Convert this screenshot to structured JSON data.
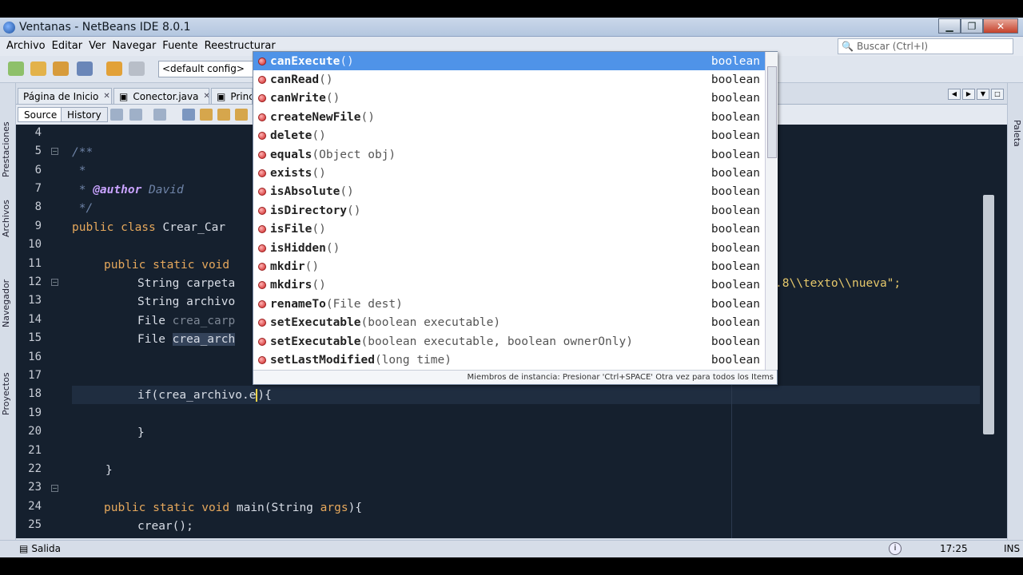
{
  "window": {
    "title": "Ventanas - NetBeans IDE 8.0.1"
  },
  "menu": {
    "items": [
      "Archivo",
      "Editar",
      "Ver",
      "Navegar",
      "Fuente",
      "Reestructurar"
    ]
  },
  "search": {
    "placeholder": "Buscar (Ctrl+I)"
  },
  "toolbar": {
    "config": "<default config>"
  },
  "left_panels": [
    "Prestaciones",
    "Archivos",
    "Navegador",
    "Proyectos"
  ],
  "right_panels": [
    "Paleta"
  ],
  "editor_tabs": [
    {
      "label": "Página de Inicio"
    },
    {
      "label": "Conector.java"
    },
    {
      "label": "Princip"
    }
  ],
  "editor_toolbar": {
    "source": "Source",
    "history": "History"
  },
  "code": {
    "line_numbers": [
      "4",
      "5",
      "6",
      "7",
      "8",
      "9",
      "10",
      "11",
      "12",
      "13",
      "14",
      "15",
      "16",
      "17",
      "18",
      "19",
      "20",
      "21",
      "22",
      "23",
      "24",
      "25"
    ],
    "l4": "/**",
    "l5": " *",
    "l7": " */",
    "l9a": "public class ",
    "l9b": "Crear_Car",
    "l11a": "public static void",
    "l12a": "String carpeta",
    "l12b": ".8\\\\texto\\\\nueva\";",
    "l13": "String archivo",
    "l14a": "File ",
    "l14b": "crea_carp",
    "l15a": "File ",
    "l15b": "crea_arch",
    "l17a": "if(",
    "l17b": "crea_archivo.e",
    "l17c": "){",
    "l19": "}",
    "l21": "}",
    "l23a": "public static void",
    "l23b": " main(String ",
    "l23c": "args",
    "l23d": "){",
    "l24": "crear();",
    "l25": "}",
    "author_tag": "@author",
    "author_name": "David"
  },
  "completion": {
    "items": [
      {
        "name": "canExecute",
        "args": "()",
        "ret": "boolean"
      },
      {
        "name": "canRead",
        "args": "()",
        "ret": "boolean"
      },
      {
        "name": "canWrite",
        "args": "()",
        "ret": "boolean"
      },
      {
        "name": "createNewFile",
        "args": "()",
        "ret": "boolean"
      },
      {
        "name": "delete",
        "args": "()",
        "ret": "boolean"
      },
      {
        "name": "equals",
        "args": "(Object obj)",
        "ret": "boolean"
      },
      {
        "name": "exists",
        "args": "()",
        "ret": "boolean"
      },
      {
        "name": "isAbsolute",
        "args": "()",
        "ret": "boolean"
      },
      {
        "name": "isDirectory",
        "args": "()",
        "ret": "boolean"
      },
      {
        "name": "isFile",
        "args": "()",
        "ret": "boolean"
      },
      {
        "name": "isHidden",
        "args": "()",
        "ret": "boolean"
      },
      {
        "name": "mkdir",
        "args": "()",
        "ret": "boolean"
      },
      {
        "name": "mkdirs",
        "args": "()",
        "ret": "boolean"
      },
      {
        "name": "renameTo",
        "args": "(File dest)",
        "ret": "boolean"
      },
      {
        "name": "setExecutable",
        "args": "(boolean executable)",
        "ret": "boolean"
      },
      {
        "name": "setExecutable",
        "args": "(boolean executable, boolean ownerOnly)",
        "ret": "boolean"
      },
      {
        "name": "setLastModified",
        "args": "(long time)",
        "ret": "boolean"
      }
    ],
    "hint": "Miembros de instancia: Presionar 'Ctrl+SPACE' Otra vez para todos los Items"
  },
  "status": {
    "output": "Salida",
    "position": "17:25",
    "mode": "INS"
  }
}
